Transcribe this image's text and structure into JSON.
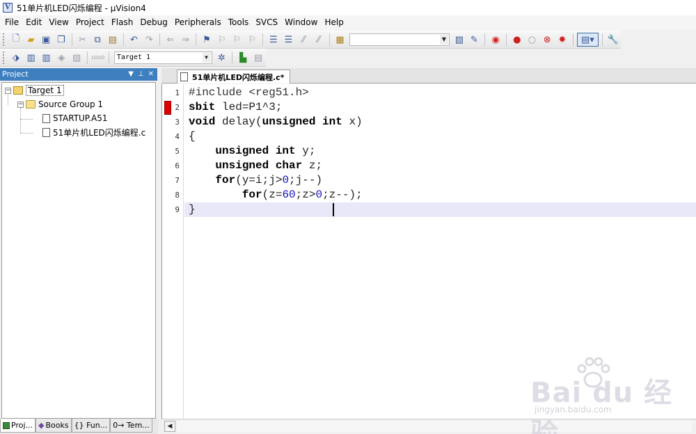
{
  "window": {
    "title": "51单片机LED闪烁编程 - μVision4"
  },
  "menu": [
    "File",
    "Edit",
    "View",
    "Project",
    "Flash",
    "Debug",
    "Peripherals",
    "Tools",
    "SVCS",
    "Window",
    "Help"
  ],
  "toolbar2": {
    "target_value": "Target 1",
    "load_label": "LOAD"
  },
  "project_pane": {
    "title": "Project",
    "tree": {
      "target": "Target 1",
      "group": "Source Group 1",
      "files": [
        "STARTUP.A51",
        "51单片机LED闪烁编程.c"
      ]
    },
    "tabs": [
      "Proj...",
      "Books",
      "{} Fun...",
      "0→ Tem..."
    ]
  },
  "editor": {
    "tab_label": "51单片机LED闪烁编程.c*",
    "breakpoint_line": 2,
    "current_line": 9,
    "lines": [
      "#include <reg51.h>",
      "sbit led=P1^3;",
      "void delay(unsigned int x)",
      "{",
      "    unsigned int y;",
      "    unsigned char z;",
      "    for(y=i;j>0;j--)",
      "        for(z=60;z>0;z--);",
      "}"
    ]
  },
  "watermark": {
    "text": "Bai du 经验",
    "sub": "jingyan.baidu.com"
  },
  "colors": {
    "breakpoint": "#e00000",
    "pane_header": "#3e7fc0",
    "current_line": "#e8e8f8"
  }
}
